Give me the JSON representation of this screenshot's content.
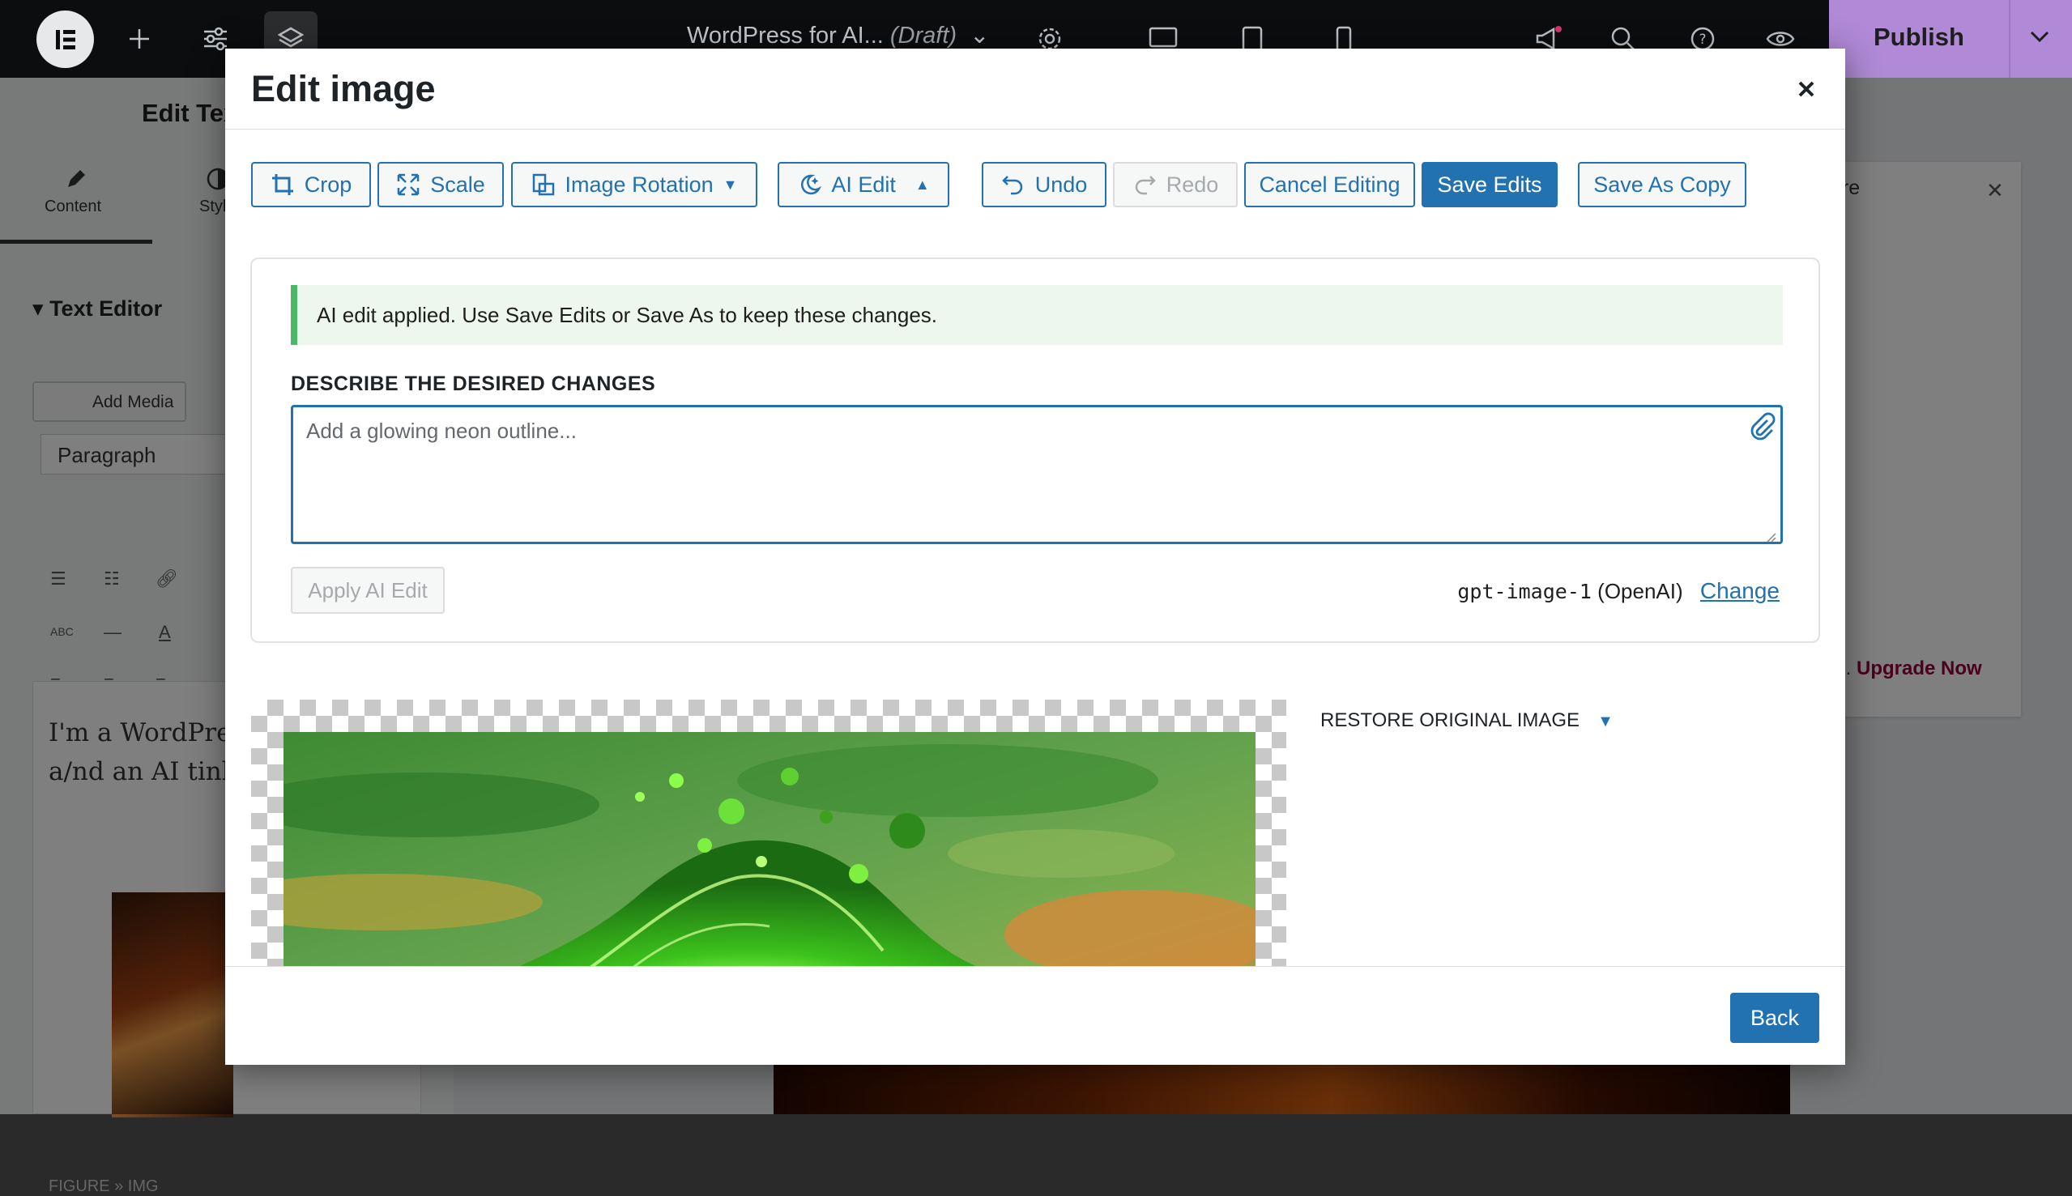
{
  "topbar": {
    "doc_title": "WordPress for AI...",
    "doc_status": "(Draft)",
    "publish_label": "Publish"
  },
  "left_panel": {
    "title": "Edit Tex",
    "tabs": [
      "Content",
      "Styl"
    ],
    "section_title": "Text Editor",
    "add_media_label": "Add Media",
    "format_select": "Paragraph",
    "editor_text": "I'm a WordPres\na/nd an AI tink",
    "footer_path": "FIGURE » IMG"
  },
  "right_panel": {
    "title": "ure",
    "upgrade_prefix": "ts.",
    "upgrade_link": "Upgrade Now"
  },
  "modal": {
    "title": "Edit image",
    "toolbar": {
      "crop": "Crop",
      "scale": "Scale",
      "rotation": "Image Rotation",
      "ai_edit": "AI Edit",
      "undo": "Undo",
      "redo": "Redo",
      "cancel": "Cancel Editing",
      "save": "Save Edits",
      "save_copy": "Save As Copy"
    },
    "notice": "AI edit applied. Use Save Edits or Save As to keep these changes.",
    "describe_label": "DESCRIBE THE DESIRED CHANGES",
    "prompt_placeholder": "Add a glowing neon outline...",
    "apply_label": "Apply AI Edit",
    "model_name": "gpt-image-1",
    "model_provider": "(OpenAI)",
    "change_label": "Change",
    "restore_label": "RESTORE ORIGINAL IMAGE",
    "back_label": "Back"
  },
  "colors": {
    "primary": "#2271b1",
    "notice_border": "#4ab866",
    "publish_bg": "#b08ad6",
    "upgrade": "#92003b"
  }
}
